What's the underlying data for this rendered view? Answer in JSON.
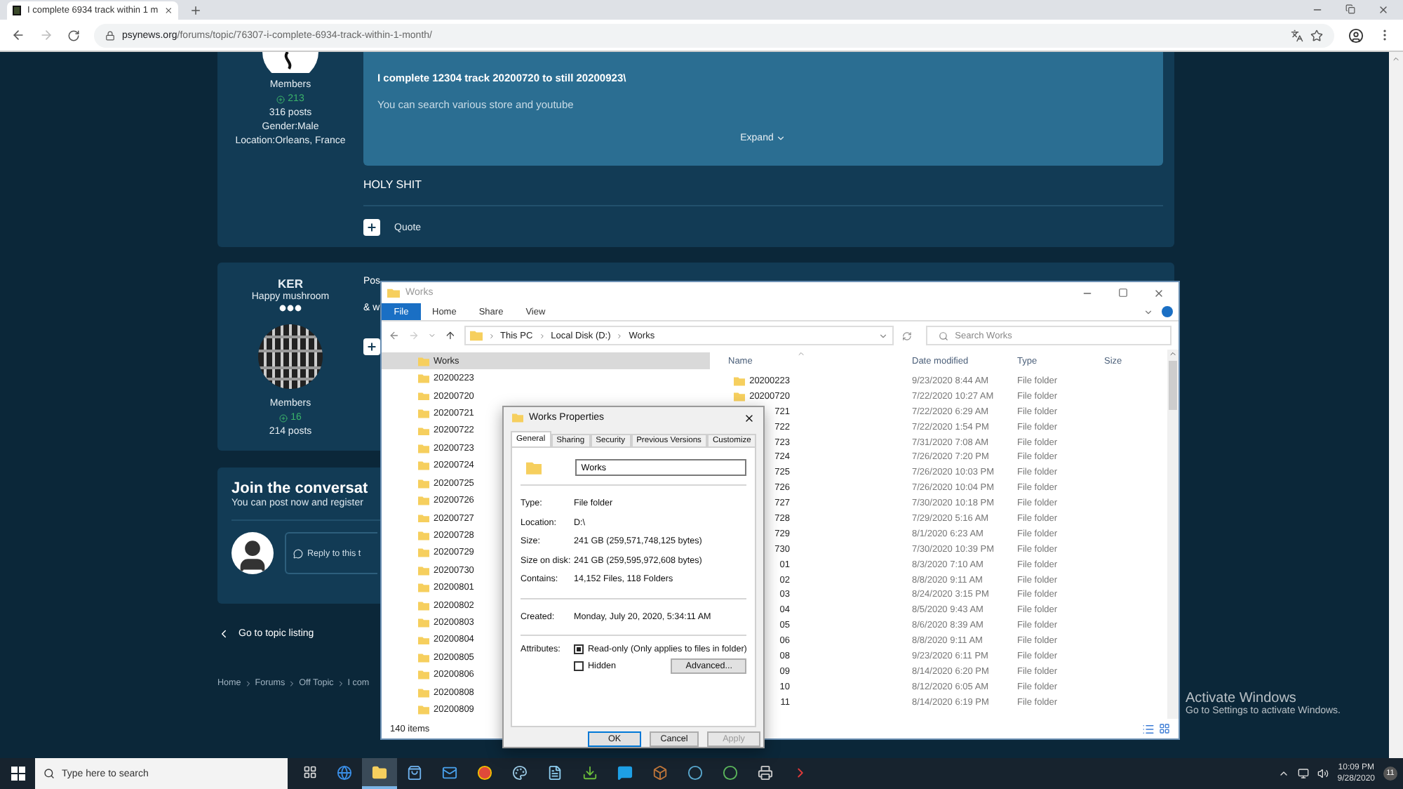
{
  "browser": {
    "tab_title": "I complete 6934 track within 1 m",
    "url_domain": "psynews.org",
    "url_path": "/forums/topic/76307-i-complete-6934-track-within-1-month/"
  },
  "post1": {
    "member_group": "Members",
    "reputation": "213",
    "post_count": "316 posts",
    "gender": "Gender:Male",
    "location": "Location:Orleans, France",
    "quote_lines": [
      "I complete 12304 track 20200720 to still 20200923\\",
      "You can search various store and youtube"
    ],
    "expand": "Expand",
    "body": "HOLY SHIT",
    "quote_label": "Quote"
  },
  "post2": {
    "author": "KER",
    "title": "Happy mushroom",
    "member_group": "Members",
    "reputation": "16",
    "post_count": "214 posts",
    "body_lines": [
      "Pos",
      "& w"
    ]
  },
  "join": {
    "heading": "Join the conversat",
    "subtext": "You can post now and register",
    "reply_placeholder": "Reply to this t"
  },
  "back_link": "Go to topic listing",
  "breadcrumb": [
    "Home",
    "Forums",
    "Off Topic",
    "I com"
  ],
  "explorer": {
    "title": "Works",
    "ribbon_tabs": [
      {
        "label": "File",
        "kind": "menu"
      },
      {
        "label": "Home",
        "kind": "tab"
      },
      {
        "label": "Share",
        "kind": "tab"
      },
      {
        "label": "View",
        "kind": "tab"
      }
    ],
    "path": [
      "This PC",
      "Local Disk (D:)",
      "Works"
    ],
    "search_placeholder": "Search Works",
    "nav": {
      "label": "Works",
      "selected": true,
      "children": [
        {
          "label": "20200223"
        },
        {
          "label": "20200720"
        },
        {
          "label": "20200721"
        },
        {
          "label": "20200722"
        },
        {
          "label": "20200723"
        },
        {
          "label": "20200724"
        },
        {
          "label": "20200725"
        },
        {
          "label": "20200726"
        },
        {
          "label": "20200727"
        },
        {
          "label": "20200728"
        },
        {
          "label": "20200729"
        },
        {
          "label": "20200730"
        },
        {
          "label": "20200801"
        },
        {
          "label": "20200802"
        },
        {
          "label": "20200803"
        },
        {
          "label": "20200804"
        },
        {
          "label": "20200805"
        },
        {
          "label": "20200806"
        },
        {
          "label": "20200808"
        },
        {
          "label": "20200809"
        }
      ]
    },
    "columns": [
      "Name",
      "Date modified",
      "Type",
      "Size"
    ],
    "rows": [
      {
        "kind": "full",
        "name": "20200223",
        "date": "9/23/2020 8:44 AM",
        "type": "File folder"
      },
      {
        "kind": "full",
        "name": "20200720",
        "date": "7/22/2020 10:27 AM",
        "type": "File folder"
      },
      {
        "kind": "clipped",
        "name": "721",
        "date": "7/22/2020 6:29 AM",
        "type": "File folder"
      },
      {
        "kind": "clipped",
        "name": "722",
        "date": "7/22/2020 1:54 PM",
        "type": "File folder"
      },
      {
        "kind": "clipped",
        "name": "723",
        "date": "7/31/2020 7:08 AM",
        "type": "File folder"
      },
      {
        "kind": "clipped",
        "name": "724",
        "date": "7/26/2020 7:20 PM",
        "type": "File folder"
      },
      {
        "kind": "clipped",
        "name": "725",
        "date": "7/26/2020 10:03 PM",
        "type": "File folder"
      },
      {
        "kind": "clipped",
        "name": "726",
        "date": "7/26/2020 10:04 PM",
        "type": "File folder"
      },
      {
        "kind": "clipped",
        "name": "727",
        "date": "7/30/2020 10:18 PM",
        "type": "File folder"
      },
      {
        "kind": "clipped",
        "name": "728",
        "date": "7/29/2020 5:16 AM",
        "type": "File folder"
      },
      {
        "kind": "clipped",
        "name": "729",
        "date": "8/1/2020 6:23 AM",
        "type": "File folder"
      },
      {
        "kind": "clipped",
        "name": "730",
        "date": "7/30/2020 10:39 PM",
        "type": "File folder"
      },
      {
        "kind": "clipped",
        "name": "01",
        "date": "8/3/2020 7:10 AM",
        "type": "File folder"
      },
      {
        "kind": "clipped",
        "name": "02",
        "date": "8/8/2020 9:11 AM",
        "type": "File folder"
      },
      {
        "kind": "clipped",
        "name": "03",
        "date": "8/24/2020 3:15 PM",
        "type": "File folder"
      },
      {
        "kind": "clipped",
        "name": "04",
        "date": "8/5/2020 9:43 AM",
        "type": "File folder"
      },
      {
        "kind": "clipped",
        "name": "05",
        "date": "8/6/2020 8:39 AM",
        "type": "File folder"
      },
      {
        "kind": "clipped",
        "name": "06",
        "date": "8/8/2020 9:11 AM",
        "type": "File folder"
      },
      {
        "kind": "clipped",
        "name": "08",
        "date": "9/23/2020 6:11 PM",
        "type": "File folder"
      },
      {
        "kind": "clipped",
        "name": "09",
        "date": "8/14/2020 6:20 PM",
        "type": "File folder"
      },
      {
        "kind": "clipped",
        "name": "10",
        "date": "8/12/2020 6:05 AM",
        "type": "File folder"
      },
      {
        "kind": "clipped",
        "name": "11",
        "date": "8/14/2020 6:19 PM",
        "type": "File folder"
      }
    ],
    "status": "140 items"
  },
  "properties": {
    "title": "Works Properties",
    "tabs": [
      {
        "label": "General",
        "selected": true
      },
      {
        "label": "Sharing",
        "selected": false
      },
      {
        "label": "Security",
        "selected": false
      },
      {
        "label": "Previous Versions",
        "selected": false
      },
      {
        "label": "Customize",
        "selected": false
      }
    ],
    "name_value": "Works",
    "details": [
      {
        "label": "Type:",
        "value": "File folder"
      },
      {
        "label": "Location:",
        "value": "D:\\"
      },
      {
        "label": "Size:",
        "value": "241 GB (259,571,748,125 bytes)"
      },
      {
        "label": "Size on disk:",
        "value": "241 GB (259,595,972,608 bytes)"
      },
      {
        "label": "Contains:",
        "value": "14,152 Files, 118 Folders"
      }
    ],
    "created": {
      "label": "Created:",
      "value": "Monday, July 20, 2020, 5:34:11 AM"
    },
    "attributes_label": "Attributes:",
    "attributes": [
      {
        "label": "Read-only (Only applies to files in folder)",
        "checked": true
      },
      {
        "label": "Hidden",
        "checked": false
      }
    ],
    "advanced": "Advanced...",
    "buttons": [
      {
        "label": "OK",
        "kind": "default"
      },
      {
        "label": "Cancel",
        "kind": "normal"
      },
      {
        "label": "Apply",
        "kind": "disabled"
      }
    ]
  },
  "activation": {
    "title": "Activate Windows",
    "text": "Go to Settings to activate Windows."
  },
  "taskbar": {
    "search_placeholder": "Type here to search",
    "apps": [
      {
        "kind": "taskview",
        "active": false
      },
      {
        "kind": "edge",
        "active": false
      },
      {
        "kind": "explorer",
        "active": true
      },
      {
        "kind": "store",
        "active": false
      },
      {
        "kind": "mail",
        "active": false
      },
      {
        "kind": "chrome",
        "active": false
      },
      {
        "kind": "paint",
        "active": false
      },
      {
        "kind": "notepad",
        "active": false
      },
      {
        "kind": "torrent",
        "active": false
      },
      {
        "kind": "skype",
        "active": false
      },
      {
        "kind": "box",
        "active": false
      },
      {
        "kind": "ring",
        "active": false
      },
      {
        "kind": "greenring",
        "active": false
      },
      {
        "kind": "printer",
        "active": false
      },
      {
        "kind": "red",
        "active": false
      }
    ],
    "time": "10:09 PM",
    "date": "9/28/2020",
    "notification_count": "11"
  }
}
